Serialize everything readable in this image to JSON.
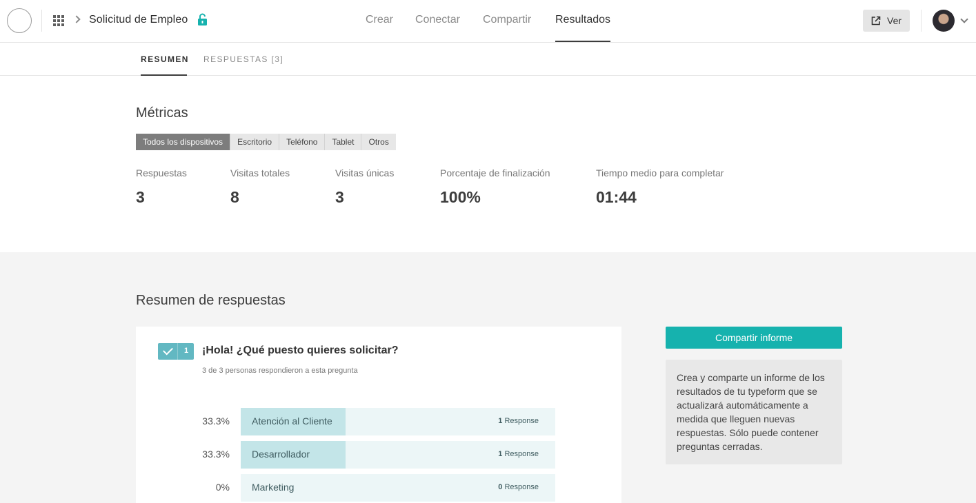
{
  "header": {
    "form_title": "Solicitud de Empleo",
    "nav": [
      {
        "label": "Crear"
      },
      {
        "label": "Conectar"
      },
      {
        "label": "Compartir"
      },
      {
        "label": "Resultados",
        "active": true
      }
    ],
    "view_button": "Ver"
  },
  "subtabs": [
    {
      "label": "RESUMEN",
      "active": true
    },
    {
      "label": "RESPUESTAS [3]"
    }
  ],
  "metrics": {
    "title": "Métricas",
    "devices": [
      {
        "label": "Todos los dispositivos",
        "active": true
      },
      {
        "label": "Escritorio"
      },
      {
        "label": "Teléfono"
      },
      {
        "label": "Tablet"
      },
      {
        "label": "Otros"
      }
    ],
    "items": [
      {
        "label": "Respuestas",
        "value": "3"
      },
      {
        "label": "Visitas totales",
        "value": "8"
      },
      {
        "label": "Visitas únicas",
        "value": "3"
      },
      {
        "label": "Porcentaje de finalización",
        "value": "100%"
      },
      {
        "label": "Tiempo medio para completar",
        "value": "01:44"
      }
    ]
  },
  "summary": {
    "title": "Resumen de respuestas",
    "question": {
      "number": "1",
      "title": "¡Hola! ¿Qué puesto quieres solicitar?",
      "subtitle": "3 de 3 personas respondieron a esta pregunta",
      "answers": [
        {
          "percent": "33.3%",
          "label": "Atención al Cliente",
          "count": "1",
          "count_label": "Response",
          "fraction": 0.333
        },
        {
          "percent": "33.3%",
          "label": "Desarrollador",
          "count": "1",
          "count_label": "Response",
          "fraction": 0.333
        },
        {
          "percent": "0%",
          "label": "Marketing",
          "count": "0",
          "count_label": "Response",
          "fraction": 0
        }
      ]
    }
  },
  "share": {
    "button": "Compartir informe",
    "info": "Crea y comparte un informe de los resultados de tu typeform que se actualizará automáticamente a medida que lleguen nuevas respuestas. Sólo puede contener preguntas cerradas."
  },
  "colors": {
    "accent": "#16b2ae",
    "bar_fill": "#c3e5e8",
    "bar_bg": "#ecf6f7",
    "badge": "#62b8c2"
  }
}
